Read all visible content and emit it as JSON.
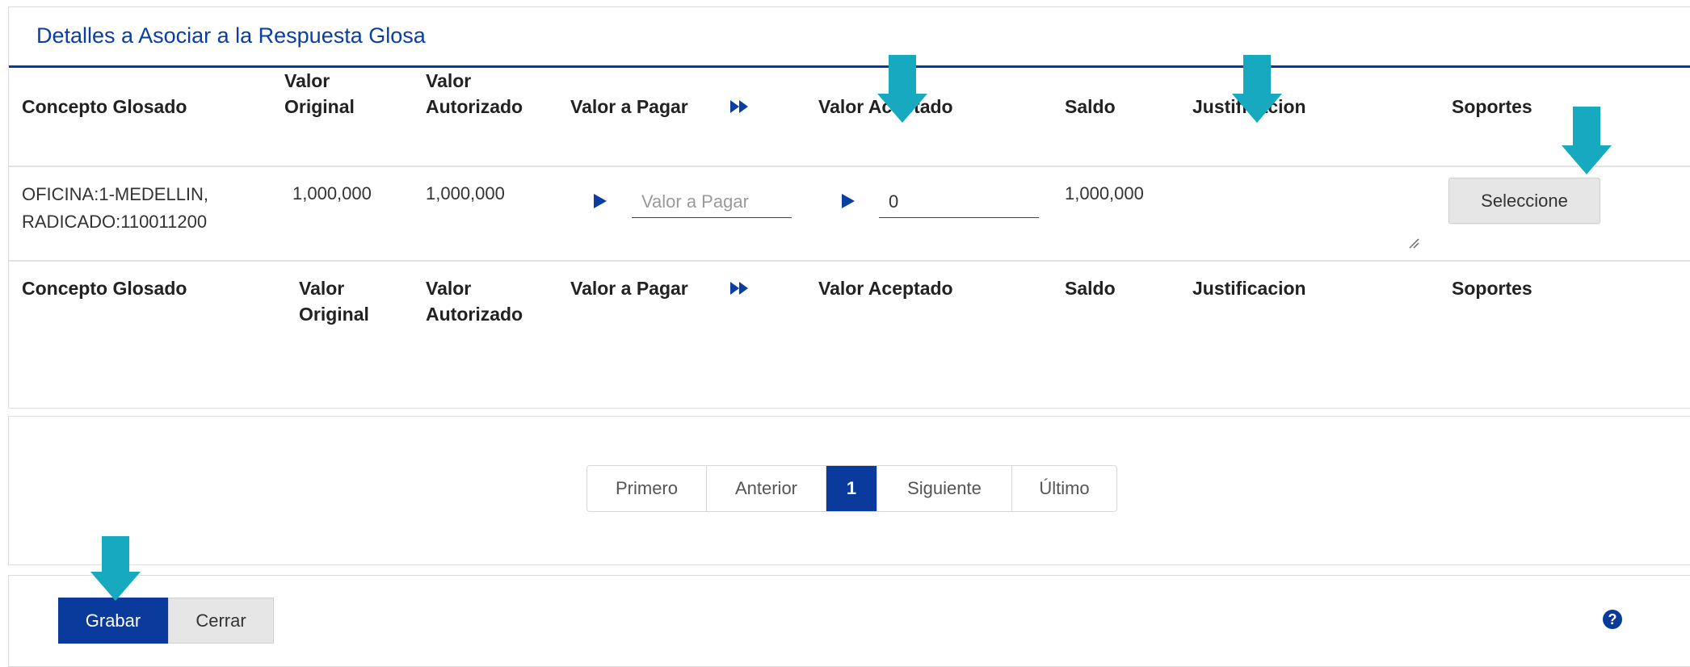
{
  "panel_title": "Detalles a Asociar a la Respuesta Glosa",
  "columns": {
    "concepto": "Concepto Glosado",
    "valor_original": [
      "Valor",
      "Original"
    ],
    "valor_autorizado": [
      "Valor",
      "Autorizado"
    ],
    "valor_pagar": "Valor a Pagar",
    "valor_aceptado": "Valor Aceptado",
    "saldo": "Saldo",
    "justificacion": "Justificacion",
    "soportes": "Soportes"
  },
  "row": {
    "concepto": [
      "OFICINA:1-MEDELLIN,",
      "RADICADO:110011200"
    ],
    "valor_original": "1,000,000",
    "valor_autorizado": "1,000,000",
    "valor_pagar_placeholder": "Valor a Pagar",
    "valor_aceptado_value": "0",
    "saldo": "1,000,000",
    "select_button": "Seleccione"
  },
  "pager": {
    "first": "Primero",
    "prev": "Anterior",
    "current": "1",
    "next": "Siguiente",
    "last": "Último"
  },
  "actions": {
    "save": "Grabar",
    "close": "Cerrar"
  },
  "icons": {
    "help": "question-circle-icon",
    "play": "play-triangle-icon",
    "fast_forward": "fast-forward-icon",
    "callout_arrow": "down-arrow-icon"
  },
  "colors": {
    "primary": "#0a3b9c",
    "callout": "#17a9bf"
  }
}
